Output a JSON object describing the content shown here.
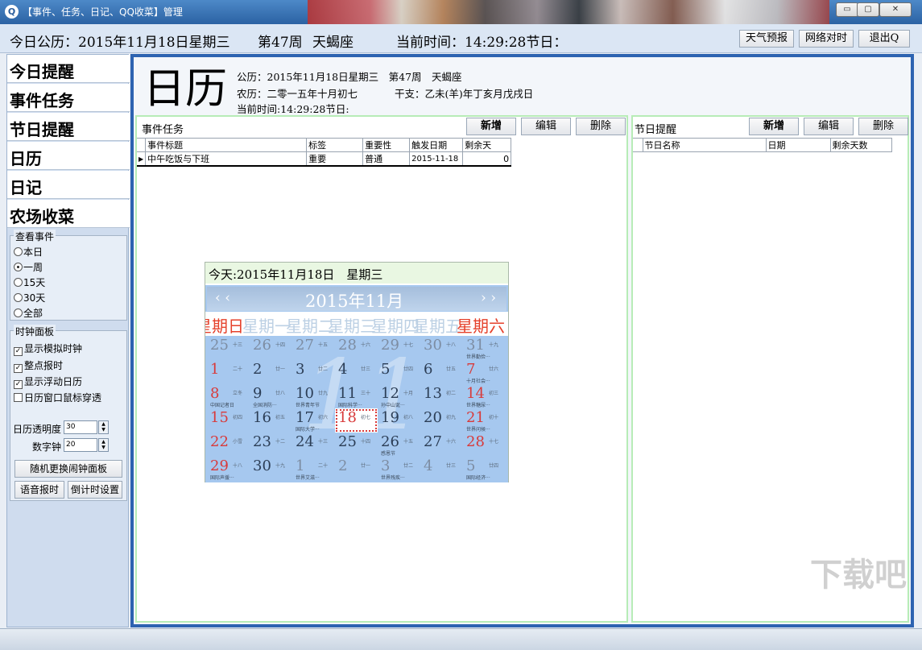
{
  "window": {
    "title": "【事件、任务、日记、QQ收菜】管理",
    "app_icon": "Q",
    "controls": {
      "minimize": "▭",
      "restore": "▢",
      "close": "✕"
    }
  },
  "header": {
    "today_gregorian": "今日公历：2015年11月18日星期三",
    "week": "第47周",
    "zodiac": "天蝎座",
    "current_time": "当前时间：14:29:28节日：",
    "buttons": {
      "weather": "天气预报",
      "sync_time": "网络对时",
      "exit": "退出Q"
    }
  },
  "sidebar": {
    "nav": [
      "今日提醒",
      "事件任务",
      "节日提醒",
      "日历",
      "日记",
      "农场收菜"
    ],
    "view_events": {
      "title": "查看事件",
      "options": [
        "本日",
        "一周",
        "15天",
        "30天",
        "全部"
      ],
      "selected_index": 1
    },
    "clock_panel": {
      "title": "时钟面板",
      "checkboxes": [
        {
          "label": "显示模拟时钟",
          "checked": true
        },
        {
          "label": "整点报时",
          "checked": true
        },
        {
          "label": "显示浮动日历",
          "checked": true
        },
        {
          "label": "日历窗口鼠标穿透",
          "checked": false
        }
      ],
      "opacity_label": "日历透明度",
      "opacity_value": "30",
      "digital_label": "数字钟",
      "digital_value": "20",
      "random_button": "随机更换闹钟面板",
      "voice_button": "语音报时",
      "countdown_button": "倒计时设置"
    }
  },
  "calendar_page": {
    "title": "日历",
    "gregorian": "公历：2015年11月18日星期三　第47周　天蝎座",
    "lunar": "农历：二零一五年十月初七",
    "ganzhi": "干支：乙未(羊)年丁亥月戊戌日",
    "current_time": "当前时间:14:29:28节日:"
  },
  "events_pane": {
    "title": "事件任务",
    "buttons": {
      "add": "新增",
      "edit": "编辑",
      "delete": "删除"
    },
    "columns": [
      "事件标题",
      "标签",
      "重要性",
      "触发日期",
      "剩余天"
    ],
    "rows": [
      [
        "中午吃饭与下班",
        "重要",
        "普通",
        "2015-11-18",
        "0"
      ]
    ]
  },
  "holiday_pane": {
    "title": "节日提醒",
    "buttons": {
      "add": "新增",
      "edit": "编辑",
      "delete": "删除"
    },
    "columns": [
      "节日名称",
      "日期",
      "剩余天数"
    ]
  },
  "mini_calendar": {
    "today_label": "今天:2015年11月18日　星期三",
    "month_label": "2015年11月",
    "prev": "‹ ‹",
    "next": "› ›",
    "weekday_strip": [
      "星期日",
      "星期一",
      "星期二",
      "星期三",
      "星期四",
      "星期五",
      "星期六"
    ],
    "watermark": "11",
    "days": [
      {
        "d": "25",
        "l": "十三",
        "f": "",
        "dim": true
      },
      {
        "d": "26",
        "l": "十四",
        "f": "",
        "dim": true
      },
      {
        "d": "27",
        "l": "十五",
        "f": "",
        "dim": true
      },
      {
        "d": "28",
        "l": "十六",
        "f": "",
        "dim": true
      },
      {
        "d": "29",
        "l": "十七",
        "f": "",
        "dim": true
      },
      {
        "d": "30",
        "l": "十八",
        "f": "",
        "dim": true
      },
      {
        "d": "31",
        "l": "十九",
        "f": "世界勤俭···",
        "dim": true
      },
      {
        "d": "1",
        "l": "二十",
        "f": "",
        "red": true
      },
      {
        "d": "2",
        "l": "廿一",
        "f": ""
      },
      {
        "d": "3",
        "l": "廿二",
        "f": ""
      },
      {
        "d": "4",
        "l": "廿三",
        "f": ""
      },
      {
        "d": "5",
        "l": "廿四",
        "f": ""
      },
      {
        "d": "6",
        "l": "廿五",
        "f": ""
      },
      {
        "d": "7",
        "l": "廿六",
        "f": "十月社会···",
        "red": true
      },
      {
        "d": "8",
        "l": "立冬",
        "f": "中国记者日",
        "red": true
      },
      {
        "d": "9",
        "l": "廿八",
        "f": "全国消防···"
      },
      {
        "d": "10",
        "l": "廿九",
        "f": "世界青年节"
      },
      {
        "d": "11",
        "l": "三十",
        "f": "国际科学···"
      },
      {
        "d": "12",
        "l": "十月",
        "f": "孙中山诞···"
      },
      {
        "d": "13",
        "l": "初二",
        "f": ""
      },
      {
        "d": "14",
        "l": "初三",
        "f": "世界糖尿···",
        "red": true
      },
      {
        "d": "15",
        "l": "初四",
        "f": "",
        "red": true
      },
      {
        "d": "16",
        "l": "初五",
        "f": ""
      },
      {
        "d": "17",
        "l": "初六",
        "f": "国际大学···"
      },
      {
        "d": "18",
        "l": "初七",
        "f": "",
        "today": true,
        "red": true
      },
      {
        "d": "19",
        "l": "初八",
        "f": ""
      },
      {
        "d": "20",
        "l": "初九",
        "f": ""
      },
      {
        "d": "21",
        "l": "初十",
        "f": "世界问候···",
        "red": true
      },
      {
        "d": "22",
        "l": "小雪",
        "f": "",
        "red": true
      },
      {
        "d": "23",
        "l": "十二",
        "f": ""
      },
      {
        "d": "24",
        "l": "十三",
        "f": ""
      },
      {
        "d": "25",
        "l": "十四",
        "f": ""
      },
      {
        "d": "26",
        "l": "十五",
        "f": "感恩节"
      },
      {
        "d": "27",
        "l": "十六",
        "f": ""
      },
      {
        "d": "28",
        "l": "十七",
        "f": "",
        "red": true
      },
      {
        "d": "29",
        "l": "十八",
        "f": "国际声援···",
        "red": true
      },
      {
        "d": "30",
        "l": "十九",
        "f": ""
      },
      {
        "d": "1",
        "l": "二十",
        "f": "世界艾滋···",
        "dim": true
      },
      {
        "d": "2",
        "l": "廿一",
        "f": "",
        "dim": true
      },
      {
        "d": "3",
        "l": "廿二",
        "f": "世界残疾···",
        "dim": true
      },
      {
        "d": "4",
        "l": "廿三",
        "f": "",
        "dim": true
      },
      {
        "d": "5",
        "l": "廿四",
        "f": "国际经济···",
        "dim": true
      }
    ]
  },
  "watermark_site": "下载吧"
}
